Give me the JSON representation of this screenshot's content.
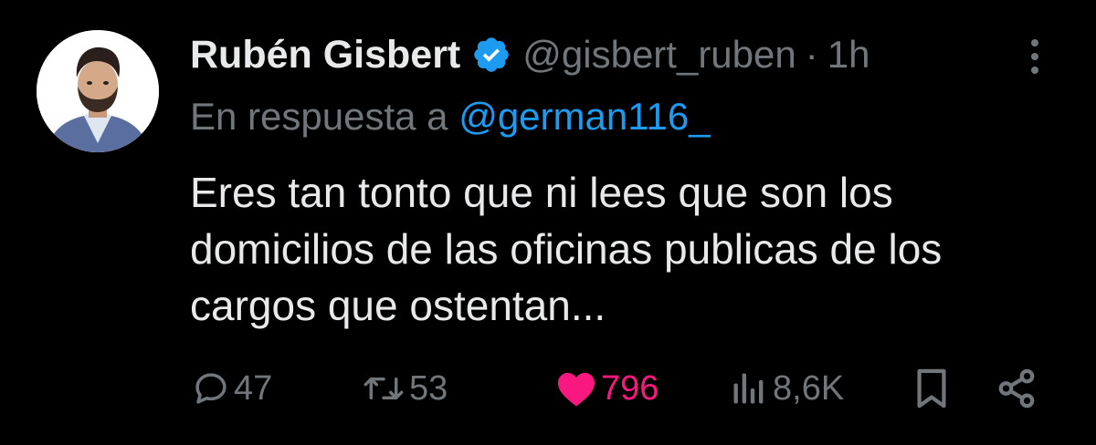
{
  "tweet": {
    "author_name": "Rubén Gisbert",
    "handle": "@gisbert_ruben",
    "separator": "·",
    "timestamp": "1h",
    "reply_prefix": "En respuesta a",
    "reply_to": "@german116_",
    "text": "Eres tan tonto que ni lees que son los\ndomicilios de las oficinas publicas de los\ncargos que ostentan...",
    "verified_icon": "verified-badge-icon",
    "more_icon": "more-options-icon"
  },
  "actions": {
    "replies": "47",
    "retweets": "53",
    "likes": "796",
    "views": "8,6K"
  },
  "colors": {
    "background": "#000000",
    "text": "#e7e9ea",
    "muted": "#71767b",
    "accent": "#1d9bf0",
    "like": "#f91880"
  }
}
